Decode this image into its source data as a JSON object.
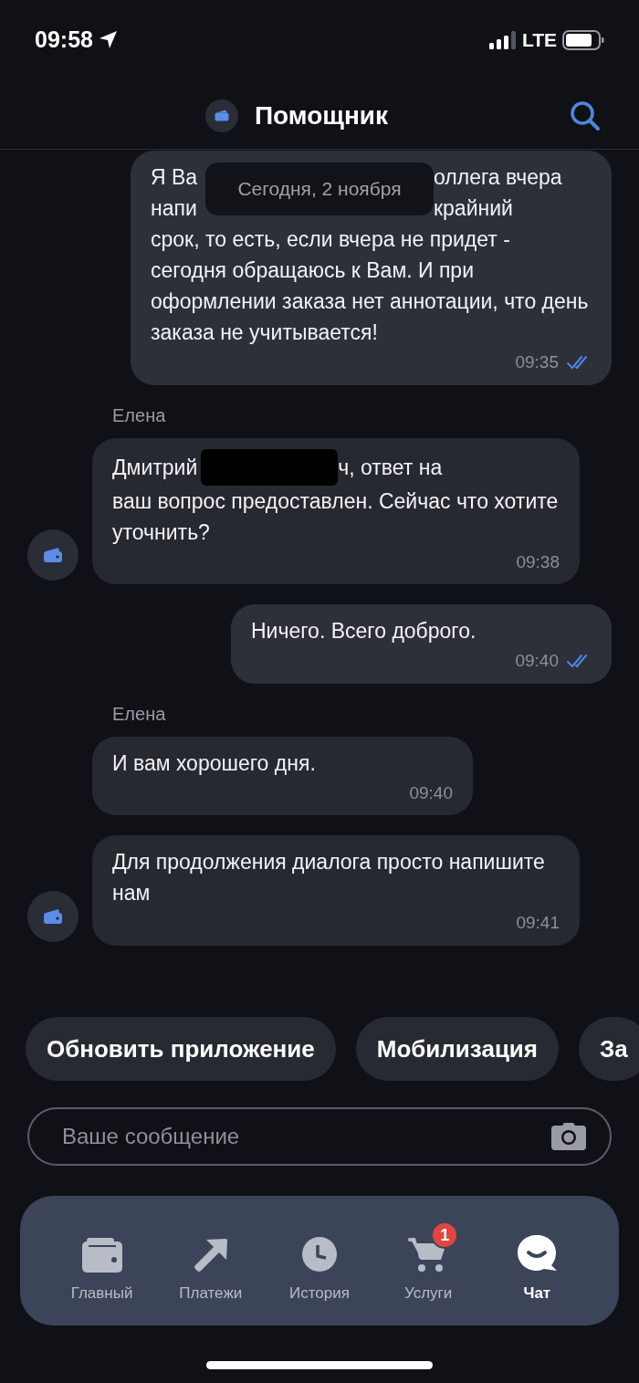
{
  "status_bar": {
    "time": "09:58",
    "network": "LTE"
  },
  "header": {
    "title": "Помощник"
  },
  "date_separator": "Сегодня, 2 ноября",
  "messages": [
    {
      "kind": "outgoing",
      "covered_lines": [
        {
          "start": "Я Ва",
          "end": "оллега вчера"
        },
        {
          "start": "напи",
          "end": "крайний"
        }
      ],
      "text": "срок, то есть, если вчера не придет - сегодня обращаюсь к Вам. И при оформлении заказа нет аннотации, что день заказа не учитывается!",
      "time": "09:35",
      "read": true
    },
    {
      "kind": "incoming",
      "sender": "Елена",
      "text_before": "Дмитрий",
      "redacted": true,
      "text_after": "ч, ответ на",
      "text": "ваш вопрос предоставлен. Сейчас что хотите уточнить?",
      "time": "09:38",
      "avatar": true
    },
    {
      "kind": "outgoing",
      "text": "Ничего. Всего доброго.",
      "time": "09:40",
      "read": true
    },
    {
      "kind": "incoming",
      "sender": "Елена",
      "text": "И вам хорошего дня.",
      "time": "09:40",
      "avatar": false
    },
    {
      "kind": "incoming",
      "text": "Для продолжения диалога просто напишите нам",
      "time": "09:41",
      "avatar": true
    }
  ],
  "quick_replies": [
    "Обновить приложение",
    "Мобилизация",
    "За"
  ],
  "input": {
    "placeholder": "Ваше сообщение"
  },
  "tab_bar": [
    {
      "label": "Главный",
      "kind": "wallet",
      "selected": false
    },
    {
      "label": "Платежи",
      "kind": "arrow",
      "selected": false
    },
    {
      "label": "История",
      "kind": "clock",
      "selected": false
    },
    {
      "label": "Услуги",
      "kind": "cart",
      "selected": false,
      "badge": "1"
    },
    {
      "label": "Чат",
      "kind": "chat",
      "selected": true
    }
  ]
}
